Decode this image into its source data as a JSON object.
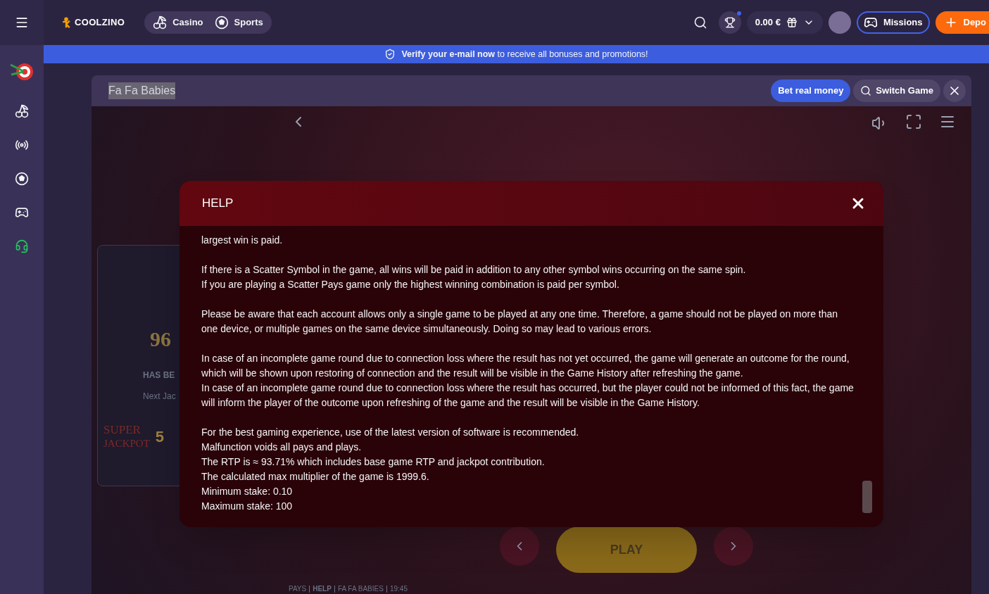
{
  "header": {
    "logo": "COOLZINO",
    "nav": [
      {
        "label": "Casino",
        "kind": "casino"
      },
      {
        "label": "Sports",
        "kind": "sports"
      }
    ],
    "balance": "0.00 €",
    "missions": "Missions",
    "deposit": "Depo"
  },
  "banner": {
    "text": "**Verify your e-mail now** to receive all bonuses and promotions!"
  },
  "game_bar": {
    "title": "Fa Fa Babies",
    "bet_button": "Bet real money",
    "switch_button": "Switch Game"
  },
  "jackpot_card": {
    "number": "96",
    "caption": "HAS BE",
    "next": "Next Jac",
    "super": "SUPER",
    "jackpot": "JACKPOT",
    "amount": "5"
  },
  "game_controls": {
    "play": "PLAY"
  },
  "game_footer": {
    "items": [
      "PAYS",
      "HELP",
      "FA FA BABIES",
      "19:45"
    ]
  },
  "help": {
    "title": "HELP",
    "groups": [
      [
        "largest win is paid."
      ],
      [
        "If there is a Scatter Symbol in the game, all wins will be paid in addition to any other symbol wins occurring on the same spin.",
        "If you are playing a Scatter Pays game only the highest winning combination is paid per symbol."
      ],
      [
        "Please be aware that each account allows only a single game to be played at any one time. Therefore, a game should not be played on more than one device, or multiple games on the same device simultaneously. Doing so may lead to various errors."
      ],
      [
        "In case of an incomplete game round due to connection loss where the result has not yet occurred, the game will generate an outcome for the round, which will be shown upon restoring of connection and the result will be visible in the Game History after refreshing the game.",
        "In case of an incomplete game round due to connection loss where the result has occurred, but the player could not be informed of this fact, the game will inform the player of the outcome upon refreshing of the game and the result will be visible in the Game History."
      ],
      [
        "For the best gaming experience, use of the latest version of software is recommended.",
        "Malfunction voids all pays and plays.",
        "The RTP is ≈ 93.71% which includes base game RTP and jackpot contribution.",
        "The calculated max multiplier of the game is 1999.6.",
        "Minimum stake: 0.10",
        "Maximum stake: 100"
      ]
    ]
  }
}
